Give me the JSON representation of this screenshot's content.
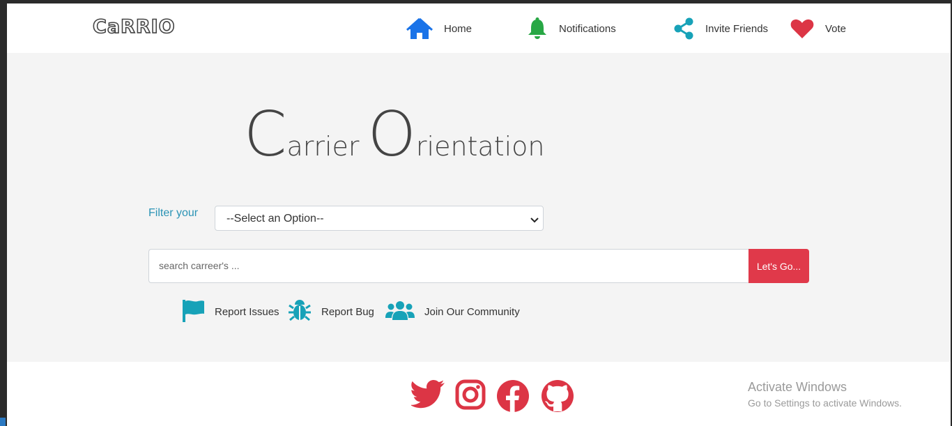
{
  "brand": {
    "logo": "CaRRIO"
  },
  "nav": {
    "home": "Home",
    "notifications": "Notifications",
    "invite": "Invite Friends",
    "vote": "Vote"
  },
  "hero": {
    "title_c": "C",
    "title_word1": "arrier ",
    "title_o": "O",
    "title_word2": "rientation"
  },
  "filter": {
    "label": "Filter your",
    "selected": "--Select an Option--"
  },
  "search": {
    "placeholder": "search carreer's ...",
    "button": "Let's Go..."
  },
  "links": {
    "report_issues": "Report Issues",
    "report_bug": "Report Bug",
    "community": "Join Our Community"
  },
  "watermark": {
    "line1": "Activate Windows",
    "line2": "Go to Settings to activate Windows."
  },
  "colors": {
    "blue": "#1a73e8",
    "green": "#28a745",
    "teal": "#17a2b8",
    "red": "#dc3545"
  }
}
